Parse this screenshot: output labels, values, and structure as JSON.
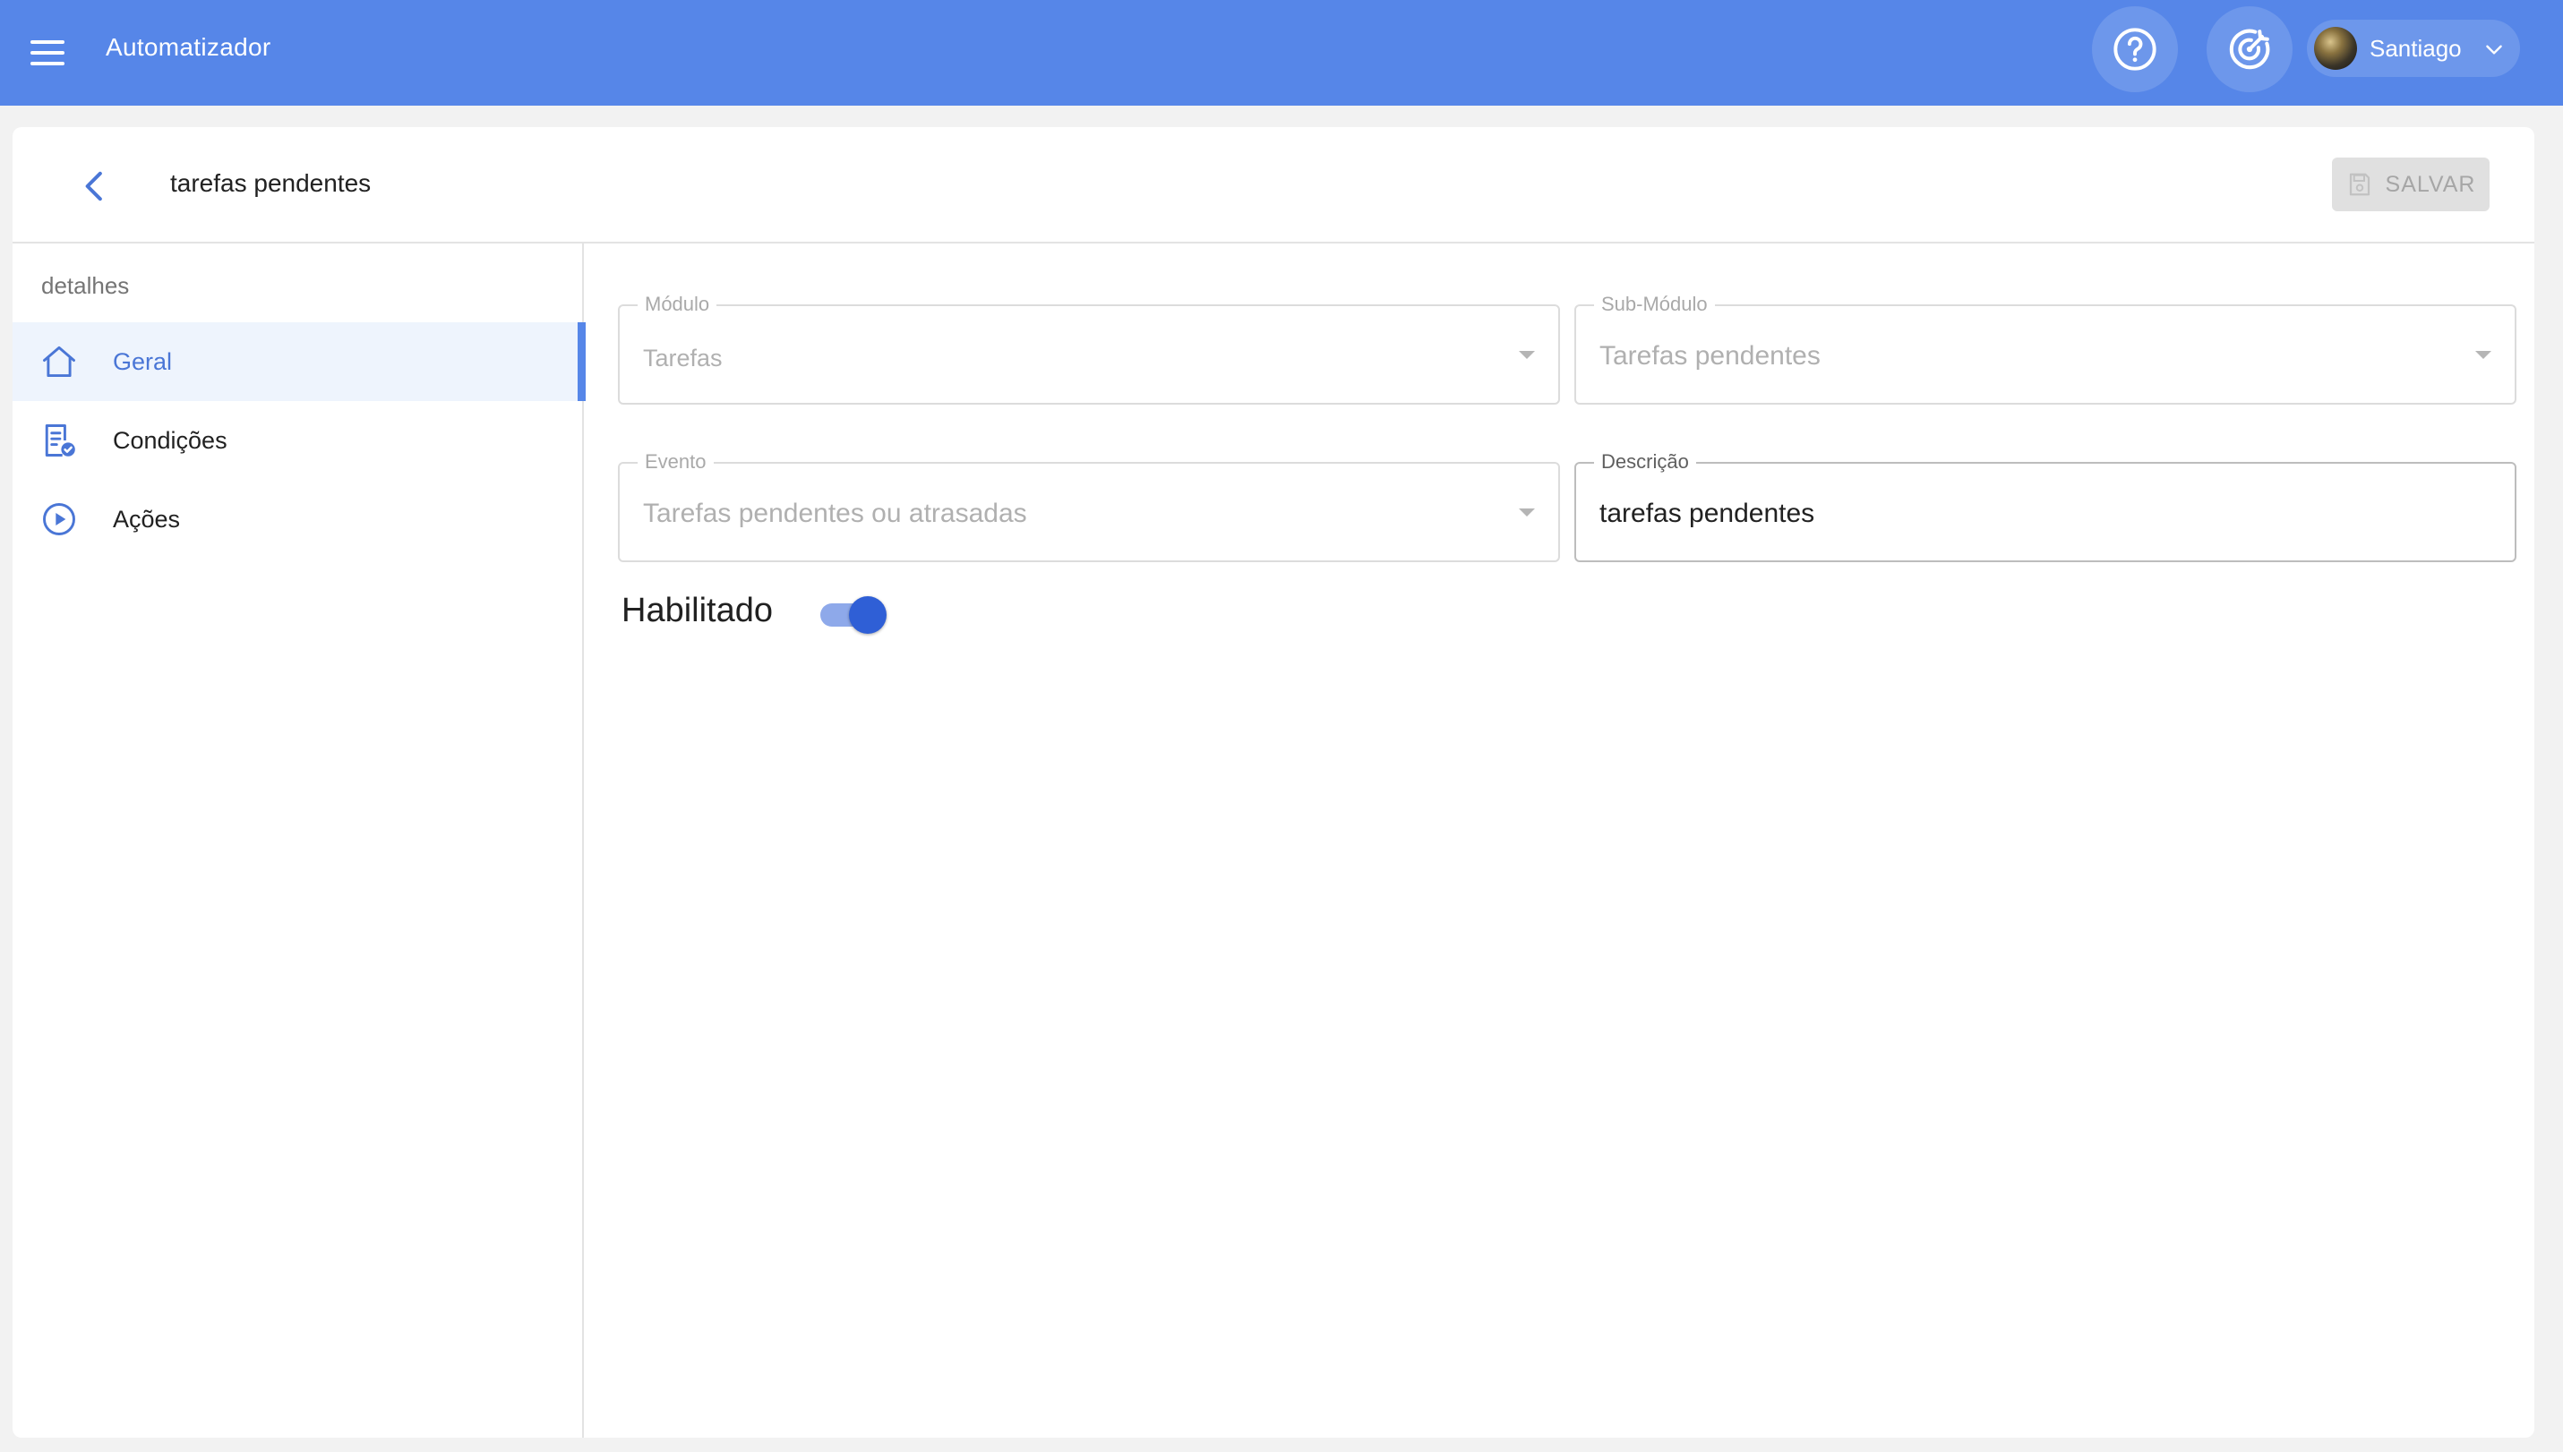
{
  "appbar": {
    "title": "Automatizador",
    "user_name": "Santiago"
  },
  "header": {
    "title": "tarefas pendentes",
    "save_label": "SALVAR"
  },
  "sidebar": {
    "heading": "detalhes",
    "items": [
      {
        "label": "Geral",
        "icon": "home-icon",
        "active": true
      },
      {
        "label": "Condições",
        "icon": "checklist-icon",
        "active": false
      },
      {
        "label": "Ações",
        "icon": "play-circle-icon",
        "active": false
      }
    ]
  },
  "form": {
    "modulo": {
      "label": "Módulo",
      "value": "Tarefas"
    },
    "submodulo": {
      "label": "Sub-Módulo",
      "value": "Tarefas pendentes"
    },
    "evento": {
      "label": "Evento",
      "value": "Tarefas pendentes ou atrasadas"
    },
    "descricao": {
      "label": "Descrição",
      "value": "tarefas pendentes"
    },
    "habilitado": {
      "label": "Habilitado",
      "enabled": true
    }
  },
  "colors": {
    "appbar": "#5686e8",
    "accent": "#4a76d6",
    "toggle_on": "#2f5fd6"
  }
}
